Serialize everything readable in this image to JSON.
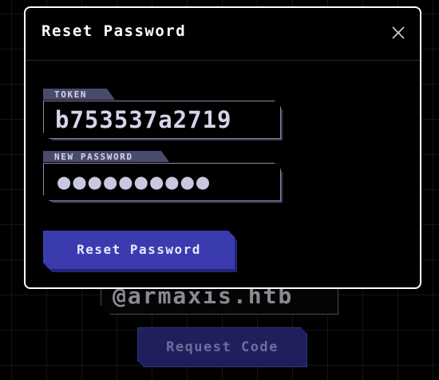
{
  "background": {
    "email_field_value": "@armaxis.htb",
    "request_code_label": "Request Code"
  },
  "modal": {
    "title": "Reset Password",
    "close_icon": "close-icon",
    "token_field": {
      "label": "TOKEN",
      "value": "b753537a2719"
    },
    "new_password_field": {
      "label": "NEW PASSWORD",
      "value": "●●●●●●●●●●"
    },
    "submit_label": "Reset Password"
  },
  "colors": {
    "accent": "#3b3bb0",
    "label_bg": "#4a4a6e",
    "border": "#ffffff"
  }
}
